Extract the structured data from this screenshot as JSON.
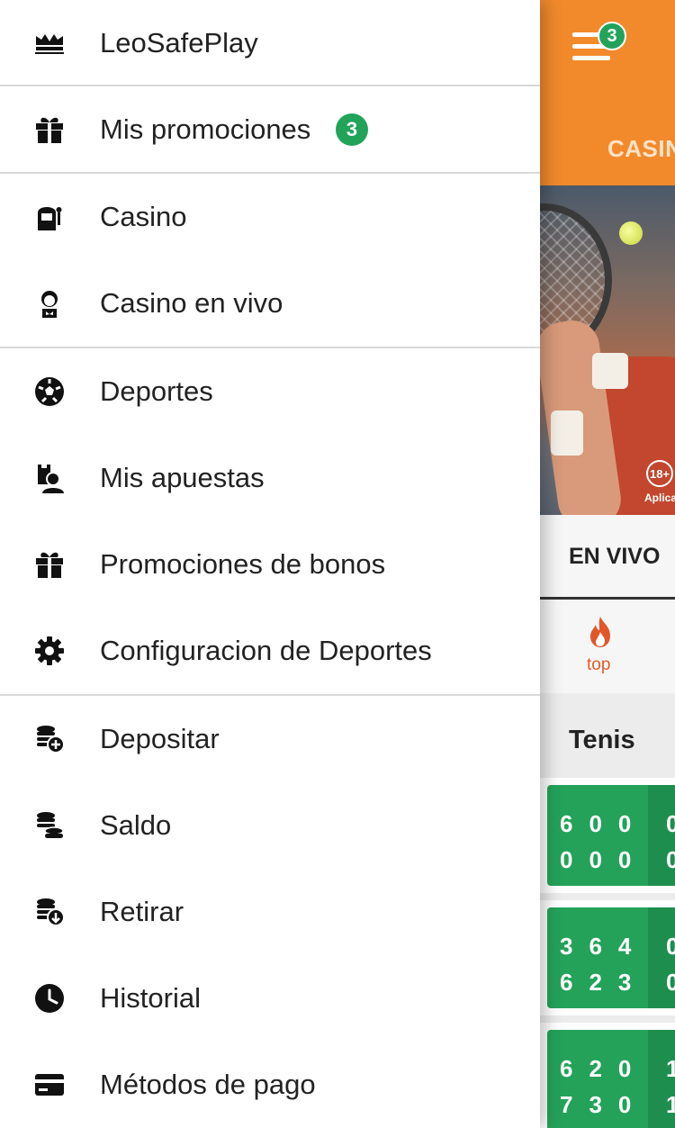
{
  "app": {
    "menu_badge_count": "3",
    "header_tab": "CASIN",
    "banner_age": "18+",
    "banner_note": "Aplica",
    "tab_live": "EN VIVO",
    "category_top": "top",
    "sport_title": "Tenis",
    "matches": [
      {
        "p1": "600",
        "p2": "000",
        "p1_extra": "0",
        "p2_extra": "0"
      },
      {
        "p1": "364",
        "p2": "623",
        "p1_extra": "0",
        "p2_extra": "0"
      },
      {
        "p1": "620",
        "p2": "730",
        "p1_extra": "1",
        "p2_extra": "1"
      }
    ],
    "colors": {
      "brand_orange": "#f28a2c",
      "badge_green": "#22a35a",
      "score_green": "#24a25a"
    }
  },
  "drawer": {
    "items": [
      {
        "label": "LeoSafePlay",
        "icon": "safe-play-icon"
      },
      {
        "label": "Mis promociones",
        "icon": "gift-icon",
        "badge": "3"
      },
      {
        "label": "Casino",
        "icon": "slot-machine-icon"
      },
      {
        "label": "Casino en vivo",
        "icon": "dealer-icon"
      },
      {
        "label": "Deportes",
        "icon": "soccer-ball-icon"
      },
      {
        "label": "Mis apuestas",
        "icon": "my-bets-icon"
      },
      {
        "label": "Promociones de bonos",
        "icon": "gift-icon"
      },
      {
        "label": "Configuracion de Deportes",
        "icon": "gear-icon"
      },
      {
        "label": "Depositar",
        "icon": "coins-plus-icon"
      },
      {
        "label": "Saldo",
        "icon": "coins-stack-icon"
      },
      {
        "label": "Retirar",
        "icon": "coins-download-icon"
      },
      {
        "label": "Historial",
        "icon": "clock-icon"
      },
      {
        "label": "Métodos de pago",
        "icon": "credit-card-icon"
      }
    ]
  }
}
